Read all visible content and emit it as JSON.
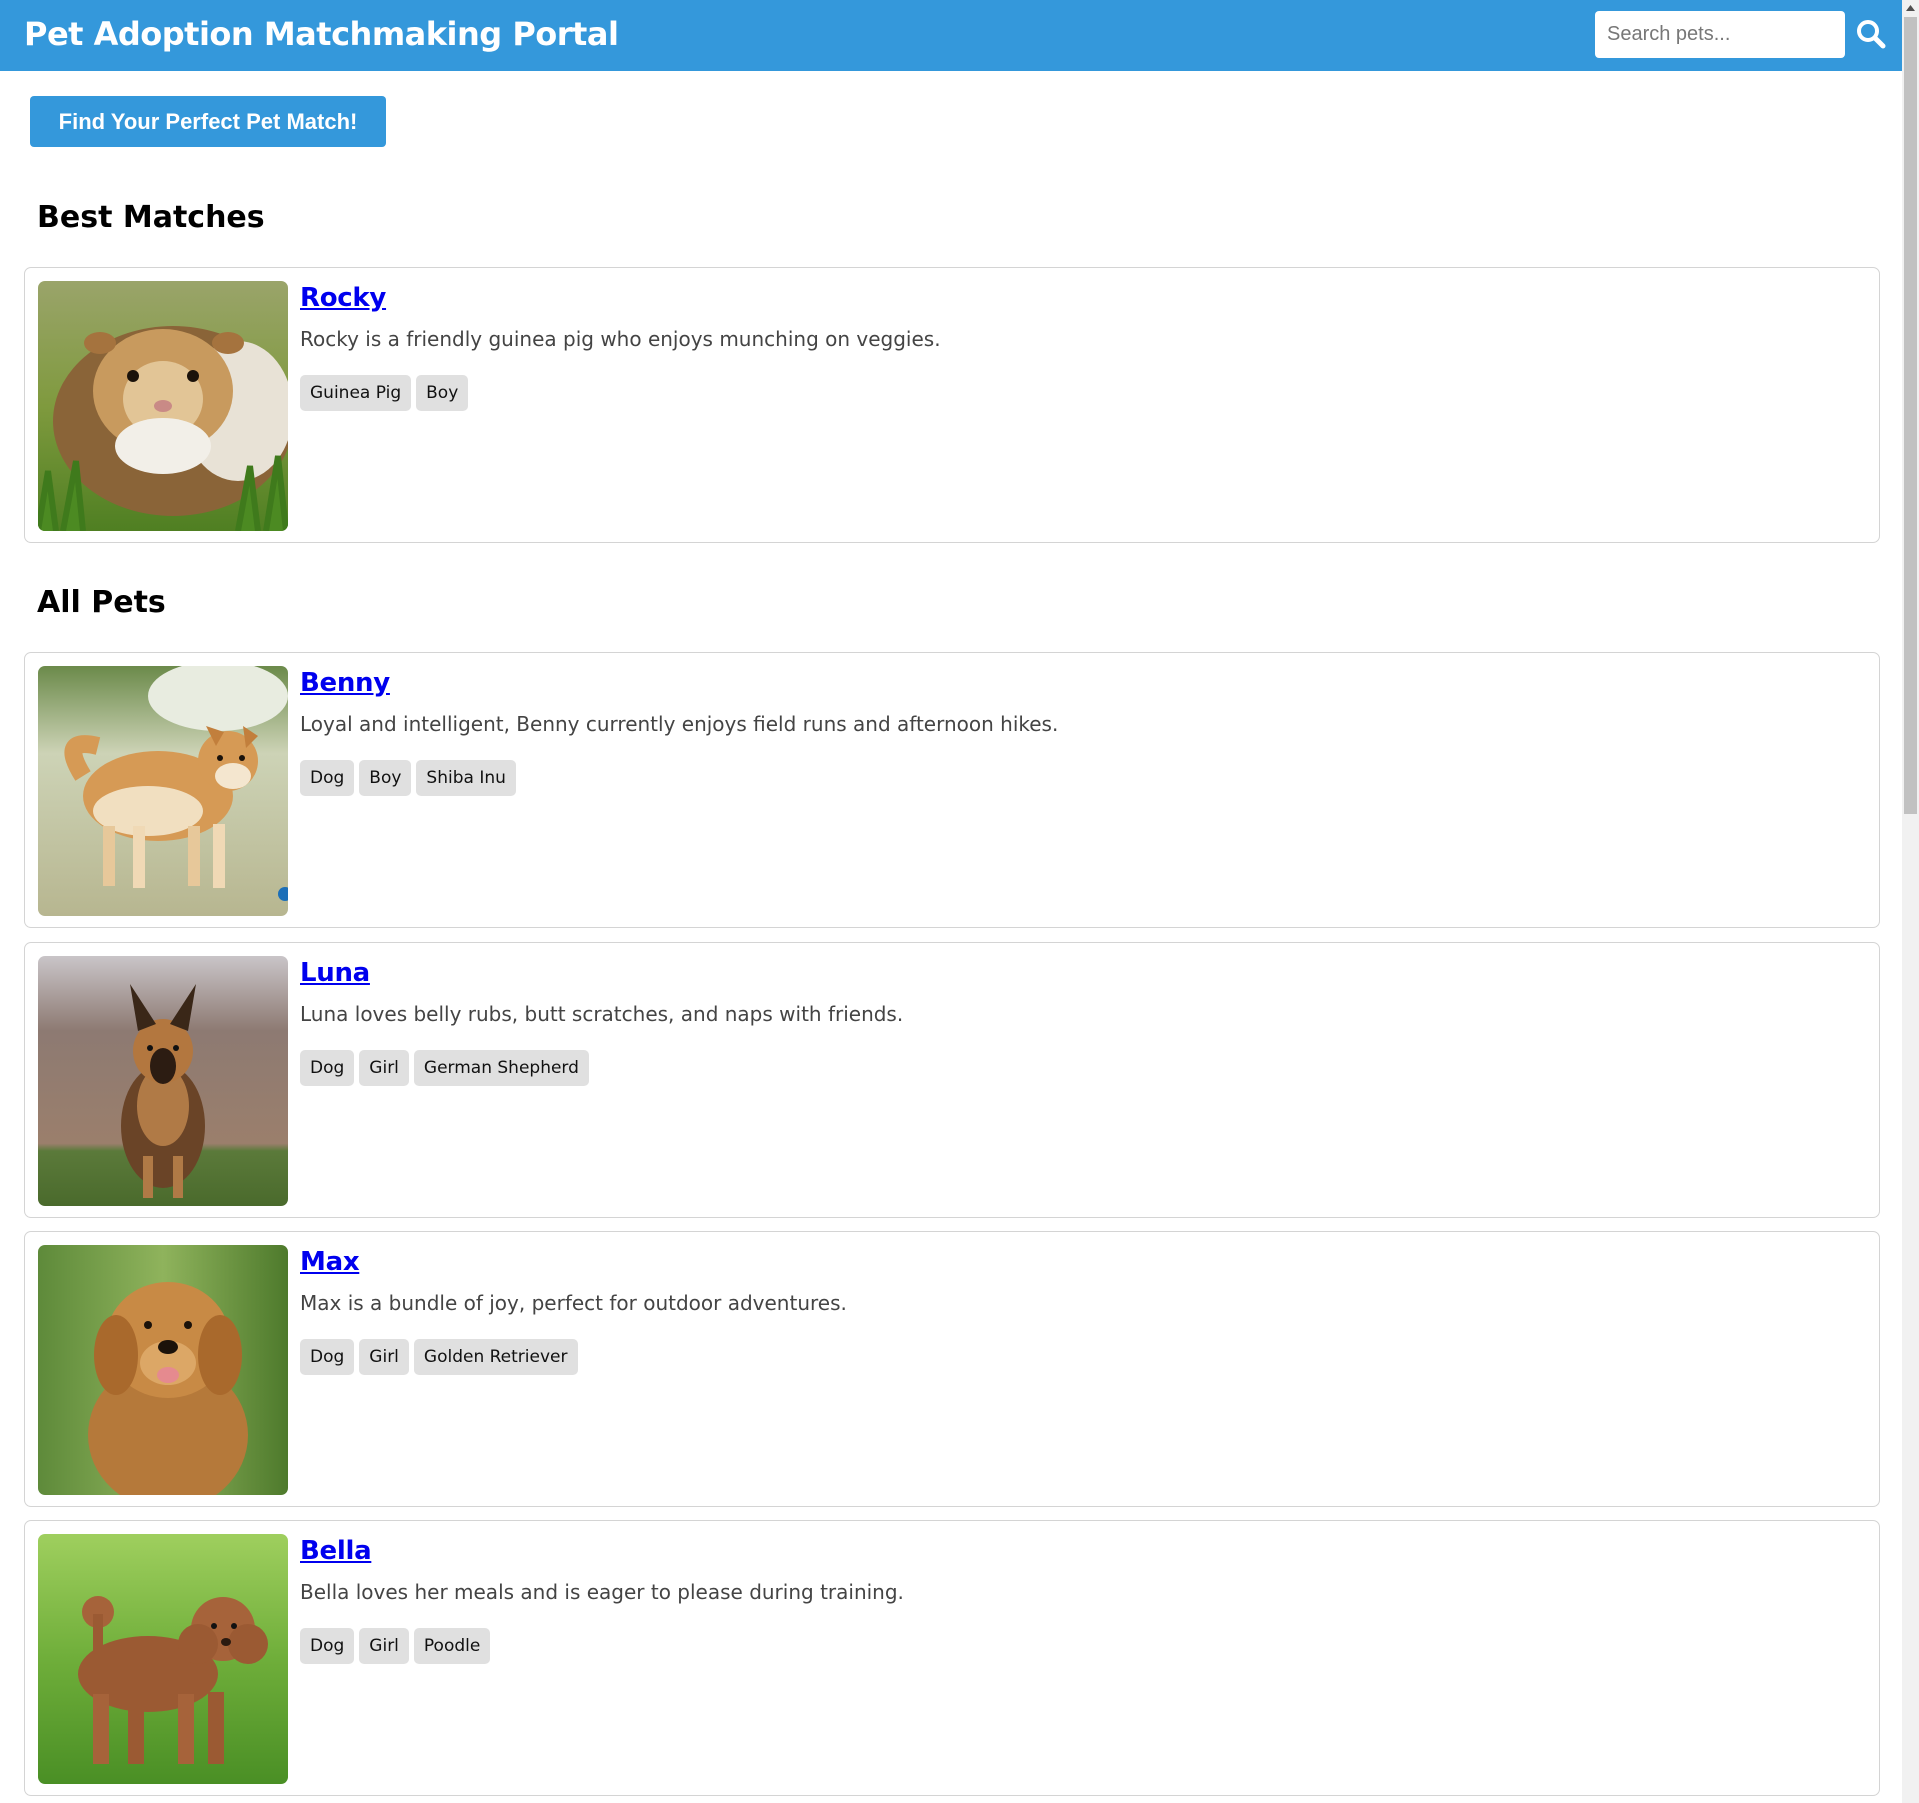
{
  "header": {
    "title": "Pet Adoption Matchmaking Portal",
    "search_placeholder": "Search pets...",
    "search_icon": "search-icon"
  },
  "cta": {
    "label": "Find Your Perfect Pet Match!"
  },
  "sections": {
    "best_matches": "Best Matches",
    "all_pets": "All Pets"
  },
  "best_matches": [
    {
      "name": "Rocky",
      "description": "Rocky is a friendly guinea pig who enjoys munching on veggies.",
      "tags": [
        "Guinea Pig",
        "Boy"
      ],
      "photo": "guinea-pig-photo"
    }
  ],
  "all_pets": [
    {
      "name": "Benny",
      "description": "Loyal and intelligent, Benny currently enjoys field runs and afternoon hikes.",
      "tags": [
        "Dog",
        "Boy",
        "Shiba Inu"
      ],
      "photo": "shiba-inu-photo"
    },
    {
      "name": "Luna",
      "description": "Luna loves belly rubs, butt scratches, and naps with friends.",
      "tags": [
        "Dog",
        "Girl",
        "German Shepherd"
      ],
      "photo": "german-shepherd-photo"
    },
    {
      "name": "Max",
      "description": "Max is a bundle of joy, perfect for outdoor adventures.",
      "tags": [
        "Dog",
        "Girl",
        "Golden Retriever"
      ],
      "photo": "golden-retriever-photo"
    },
    {
      "name": "Bella",
      "description": "Bella loves her meals and is eager to please during training.",
      "tags": [
        "Dog",
        "Girl",
        "Poodle"
      ],
      "photo": "poodle-photo"
    }
  ],
  "colors": {
    "brand": "#3498db",
    "link": "#0000ee",
    "tag_bg": "#e0e0e0",
    "card_border": "#d4d4d4"
  }
}
